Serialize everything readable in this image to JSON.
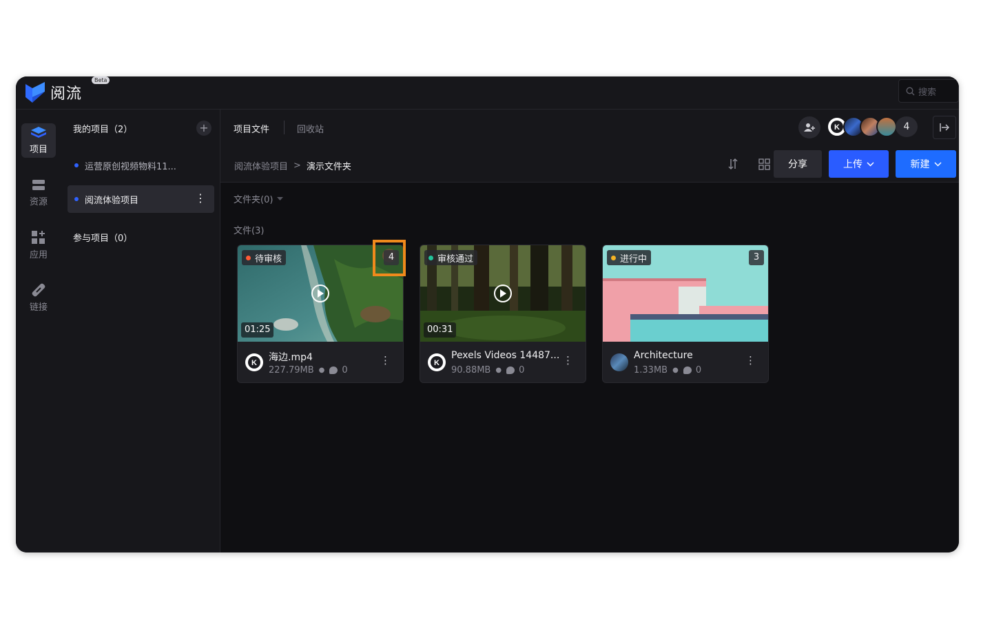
{
  "app": {
    "name": "阅流",
    "badge": "Beta"
  },
  "search": {
    "placeholder": "搜索"
  },
  "rail": [
    {
      "label": "项目",
      "icon": "stack-icon",
      "active": true
    },
    {
      "label": "资源",
      "icon": "storage-icon"
    },
    {
      "label": "应用",
      "icon": "apps-icon"
    },
    {
      "label": "链接",
      "icon": "link-icon"
    }
  ],
  "sidebar": {
    "my_projects": "我的项目（2）",
    "add": "+",
    "projects": [
      {
        "label": "运营原创视频物料11...",
        "active": false
      },
      {
        "label": "阅流体验项目",
        "active": true
      }
    ],
    "joined": "参与项目（0）"
  },
  "tabs": {
    "files": "项目文件",
    "recycle": "回收站"
  },
  "members": {
    "count": "4"
  },
  "breadcrumb": {
    "parent": "阅流体验项目",
    "current": "演示文件夹",
    "separator": ">"
  },
  "buttons": {
    "share": "分享",
    "upload": "上传",
    "create": "新建"
  },
  "sections": {
    "folders": "文件夹(0)",
    "files": "文件(3)"
  },
  "files": [
    {
      "status": "待审核",
      "status_color": "#ff5a36",
      "versions": "4",
      "duration": "01:25",
      "name": "海边.mp4",
      "size": "227.79MB",
      "comments": "0"
    },
    {
      "status": "审核通过",
      "status_color": "#22c39a",
      "versions": "",
      "duration": "00:31",
      "name": "Pexels Videos 14487...",
      "size": "90.88MB",
      "comments": "0"
    },
    {
      "status": "进行中",
      "status_color": "#f5b324",
      "versions": "3",
      "duration": "",
      "name": "Architecture",
      "size": "1.33MB",
      "comments": "0"
    }
  ],
  "colors": {
    "accent": "#2a5cff",
    "highlight": "#f08a1c"
  }
}
